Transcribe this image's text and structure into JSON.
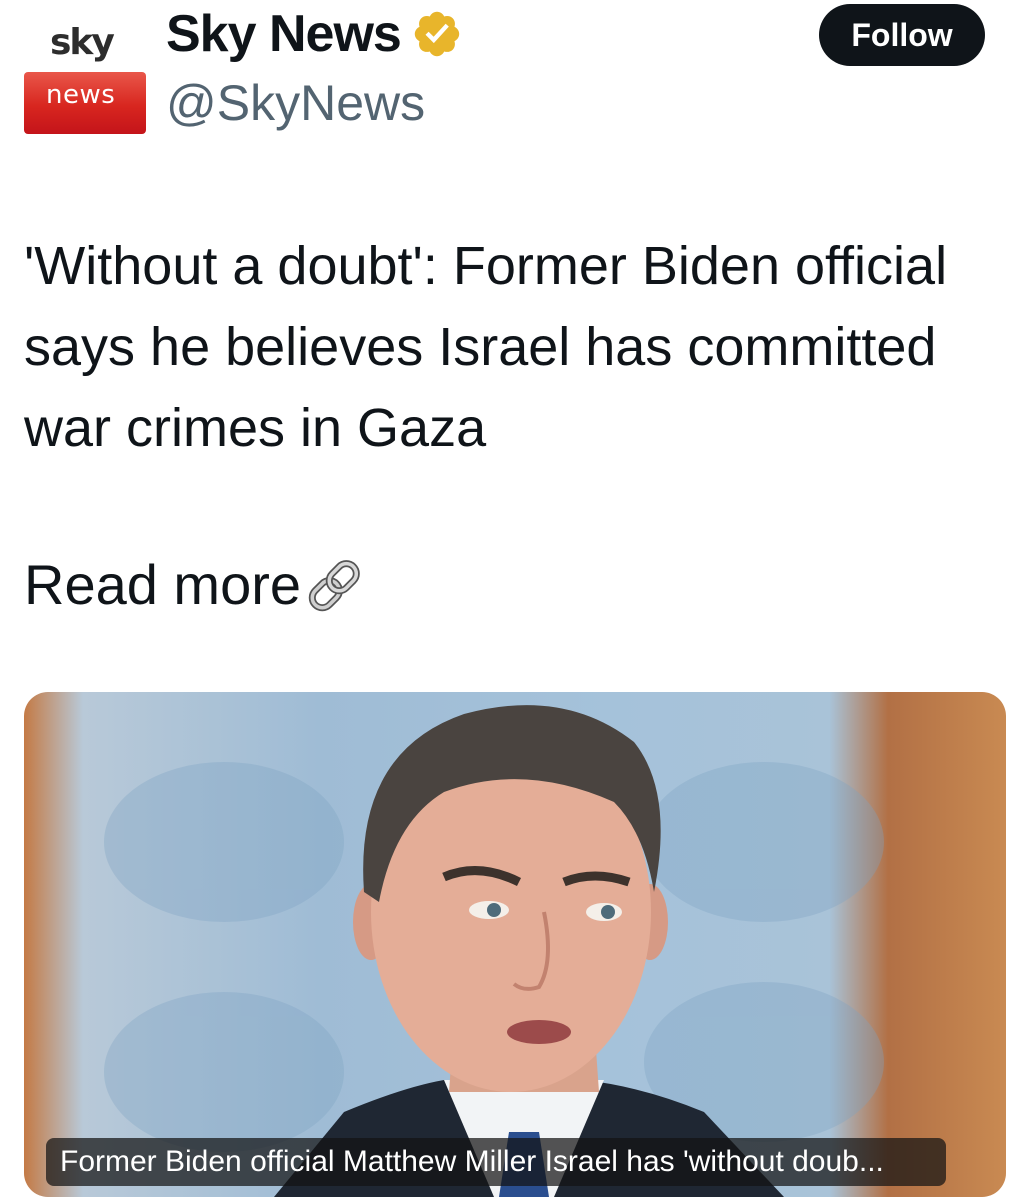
{
  "account": {
    "logo_top": "sky",
    "logo_bottom": "news",
    "display_name": "Sky News",
    "handle": "@SkyNews",
    "verified_icon": "verified-badge-gold"
  },
  "follow_label": "Follow",
  "tweet": {
    "text": "'Without a doubt': Former Biden official says he believes Israel has committed war crimes in Gaza",
    "read_more": "Read more",
    "link_icon": "link-chain-icon"
  },
  "media": {
    "caption": "Former Biden official Matthew Miller Israel has 'without doub..."
  },
  "colors": {
    "follow_bg": "#0f1419",
    "handle": "#536471",
    "verified_gold": "#e8b52b",
    "sky_red": "#d8261f"
  }
}
